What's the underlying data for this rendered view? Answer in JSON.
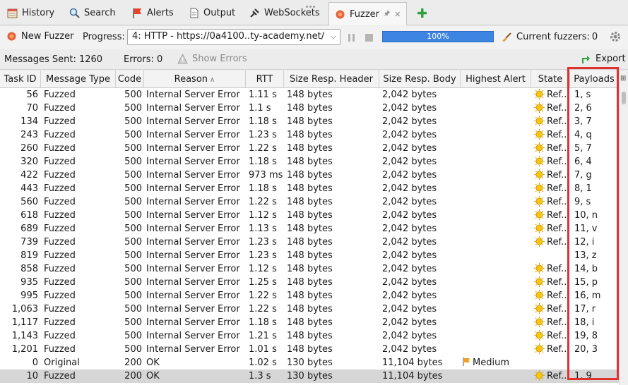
{
  "tabs": [
    {
      "label": "History",
      "icon": "history-icon"
    },
    {
      "label": "Search",
      "icon": "search-icon"
    },
    {
      "label": "Alerts",
      "icon": "alerts-flag-icon"
    },
    {
      "label": "Output",
      "icon": "output-icon"
    },
    {
      "label": "WebSockets",
      "icon": "websockets-icon"
    },
    {
      "label": "Fuzzer",
      "icon": "fuzzer-icon"
    }
  ],
  "toolbar": {
    "new_fuzzer": "New Fuzzer",
    "progress_label": "Progress:",
    "progress_select": "4: HTTP - https://0a4100..ty-academy.net/",
    "progress_pct": "100%",
    "progress_fraction": 1.0,
    "current_fuzzers": "Current fuzzers:",
    "current_fuzzers_count": "0"
  },
  "status": {
    "messages_sent": "Messages Sent: 1260",
    "errors": "Errors: 0",
    "show_errors": "Show Errors",
    "export": "Export"
  },
  "columns": [
    "Task ID",
    "Message Type",
    "Code",
    "Reason",
    "RTT",
    "Size Resp. Header",
    "Size Resp. Body",
    "Highest Alert",
    "State",
    "Payloads"
  ],
  "rows": [
    [
      "56",
      "Fuzzed",
      "500",
      "Internal Server Error",
      "1.11 s",
      "148 bytes",
      "2,042 bytes",
      "",
      "Ref...",
      "1, s"
    ],
    [
      "70",
      "Fuzzed",
      "500",
      "Internal Server Error",
      "1.1 s",
      "148 bytes",
      "2,042 bytes",
      "",
      "Ref...",
      "2, 6"
    ],
    [
      "134",
      "Fuzzed",
      "500",
      "Internal Server Error",
      "1.18 s",
      "148 bytes",
      "2,042 bytes",
      "",
      "Ref...",
      "3, 7"
    ],
    [
      "243",
      "Fuzzed",
      "500",
      "Internal Server Error",
      "1.23 s",
      "148 bytes",
      "2,042 bytes",
      "",
      "Ref...",
      "4, q"
    ],
    [
      "260",
      "Fuzzed",
      "500",
      "Internal Server Error",
      "1.22 s",
      "148 bytes",
      "2,042 bytes",
      "",
      "Ref...",
      "5, 7"
    ],
    [
      "320",
      "Fuzzed",
      "500",
      "Internal Server Error",
      "1.18 s",
      "148 bytes",
      "2,042 bytes",
      "",
      "Ref...",
      "6, 4"
    ],
    [
      "422",
      "Fuzzed",
      "500",
      "Internal Server Error",
      "973 ms",
      "148 bytes",
      "2,042 bytes",
      "",
      "Ref...",
      "7, g"
    ],
    [
      "443",
      "Fuzzed",
      "500",
      "Internal Server Error",
      "1.18 s",
      "148 bytes",
      "2,042 bytes",
      "",
      "Ref...",
      "8, 1"
    ],
    [
      "560",
      "Fuzzed",
      "500",
      "Internal Server Error",
      "1.22 s",
      "148 bytes",
      "2,042 bytes",
      "",
      "Ref...",
      "9, s"
    ],
    [
      "618",
      "Fuzzed",
      "500",
      "Internal Server Error",
      "1.12 s",
      "148 bytes",
      "2,042 bytes",
      "",
      "Ref...",
      "10, n"
    ],
    [
      "689",
      "Fuzzed",
      "500",
      "Internal Server Error",
      "1.13 s",
      "148 bytes",
      "2,042 bytes",
      "",
      "Ref...",
      "11, v"
    ],
    [
      "739",
      "Fuzzed",
      "500",
      "Internal Server Error",
      "1.23 s",
      "148 bytes",
      "2,042 bytes",
      "",
      "Ref...",
      "12, i"
    ],
    [
      "819",
      "Fuzzed",
      "500",
      "Internal Server Error",
      "1.23 s",
      "148 bytes",
      "2,042 bytes",
      "",
      "",
      "13, z"
    ],
    [
      "858",
      "Fuzzed",
      "500",
      "Internal Server Error",
      "1.12 s",
      "148 bytes",
      "2,042 bytes",
      "",
      "Ref...",
      "14, b"
    ],
    [
      "935",
      "Fuzzed",
      "500",
      "Internal Server Error",
      "1.25 s",
      "148 bytes",
      "2,042 bytes",
      "",
      "Ref...",
      "15, p"
    ],
    [
      "995",
      "Fuzzed",
      "500",
      "Internal Server Error",
      "1.22 s",
      "148 bytes",
      "2,042 bytes",
      "",
      "Ref...",
      "16, m"
    ],
    [
      "1,063",
      "Fuzzed",
      "500",
      "Internal Server Error",
      "1.22 s",
      "148 bytes",
      "2,042 bytes",
      "",
      "Ref...",
      "17, r"
    ],
    [
      "1,117",
      "Fuzzed",
      "500",
      "Internal Server Error",
      "1.18 s",
      "148 bytes",
      "2,042 bytes",
      "",
      "Ref...",
      "18, i"
    ],
    [
      "1,143",
      "Fuzzed",
      "500",
      "Internal Server Error",
      "1.21 s",
      "148 bytes",
      "2,042 bytes",
      "",
      "Ref...",
      "19, 8"
    ],
    [
      "1,201",
      "Fuzzed",
      "500",
      "Internal Server Error",
      "1.01 s",
      "148 bytes",
      "2,042 bytes",
      "",
      "Ref...",
      "20, 3"
    ],
    [
      "0",
      "Original",
      "200",
      "OK",
      "1.02 s",
      "130 bytes",
      "11,104 bytes",
      "Medium",
      "",
      ""
    ],
    [
      "10",
      "Fuzzed",
      "200",
      "OK",
      "1.3 s",
      "130 bytes",
      "11,104 bytes",
      "",
      "Ref...",
      "1, 9"
    ]
  ],
  "selected_row": 21,
  "colors": {
    "highlight": "#e03131",
    "progress": "#3d85e0",
    "add": "#2ea043"
  }
}
